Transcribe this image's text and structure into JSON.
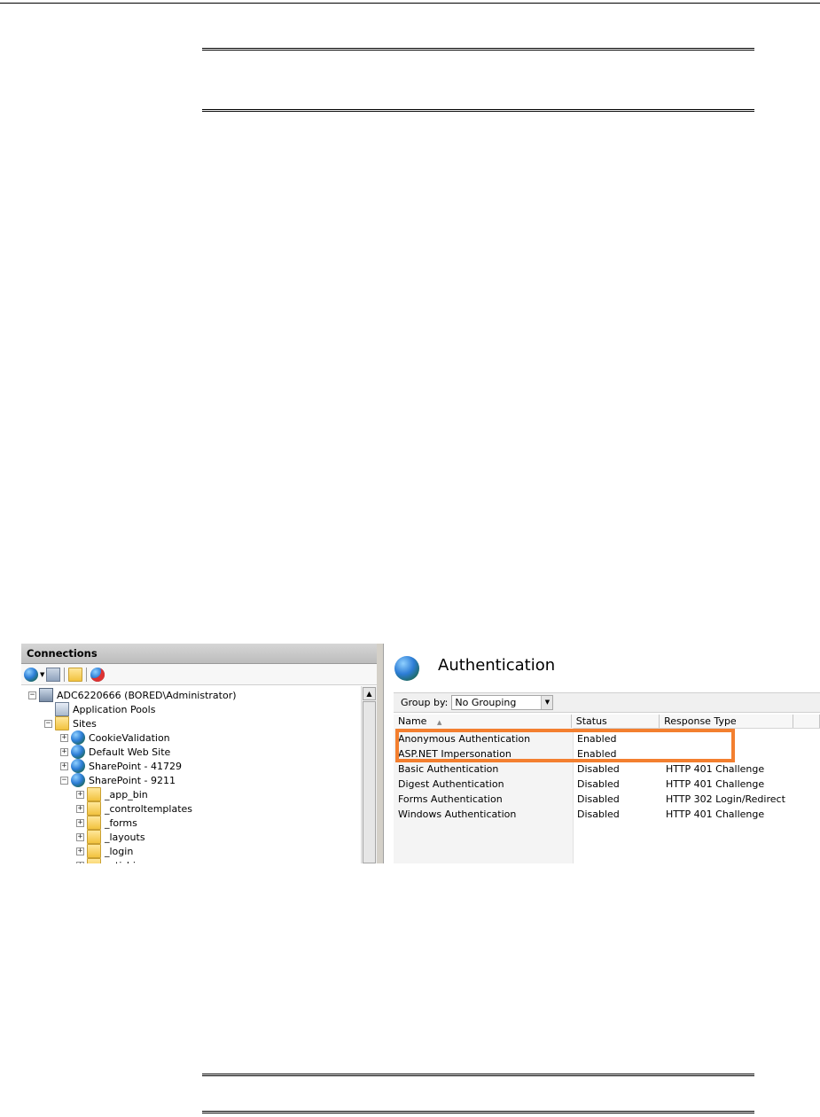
{
  "connections": {
    "title": "Connections",
    "toolbar_icons": [
      "connect-icon",
      "save-icon",
      "up-folder-icon",
      "disconnect-icon"
    ],
    "tree": [
      {
        "label": "ADC6220666 (BORED\\Administrator)",
        "level": 0,
        "icon": "server-icon",
        "expander": "−"
      },
      {
        "label": "Application Pools",
        "level": 1,
        "icon": "app-pool-icon",
        "expander": ""
      },
      {
        "label": "Sites",
        "level": 1,
        "icon": "sites-folder-icon",
        "expander": "−"
      },
      {
        "label": "CookieValidation",
        "level": 2,
        "icon": "globe-icon",
        "expander": "+"
      },
      {
        "label": "Default Web Site",
        "level": 2,
        "icon": "globe-icon",
        "expander": "+"
      },
      {
        "label": "SharePoint - 41729",
        "level": 2,
        "icon": "globe-icon",
        "expander": "+"
      },
      {
        "label": "SharePoint - 9211",
        "level": 2,
        "icon": "globe-icon",
        "expander": "−"
      },
      {
        "label": "_app_bin",
        "level": 3,
        "icon": "folder-icon",
        "expander": "+"
      },
      {
        "label": "_controltemplates",
        "level": 3,
        "icon": "folder-icon",
        "expander": "+"
      },
      {
        "label": "_forms",
        "level": 3,
        "icon": "folder-icon",
        "expander": "+"
      },
      {
        "label": "_layouts",
        "level": 3,
        "icon": "folder-icon",
        "expander": "+"
      },
      {
        "label": "_login",
        "level": 3,
        "icon": "folder-icon",
        "expander": "+"
      },
      {
        "label": "_vti_bin",
        "level": 3,
        "icon": "folder-icon",
        "expander": "+"
      }
    ]
  },
  "auth": {
    "title": "Authentication",
    "group_by_label": "Group by:",
    "group_by_value": "No Grouping",
    "columns": [
      "Name",
      "Status",
      "Response Type"
    ],
    "rows": [
      {
        "name": "Anonymous Authentication",
        "status": "Enabled",
        "response": ""
      },
      {
        "name": "ASP.NET Impersonation",
        "status": "Enabled",
        "response": ""
      },
      {
        "name": "Basic Authentication",
        "status": "Disabled",
        "response": "HTTP 401 Challenge"
      },
      {
        "name": "Digest Authentication",
        "status": "Disabled",
        "response": "HTTP 401 Challenge"
      },
      {
        "name": "Forms Authentication",
        "status": "Disabled",
        "response": "HTTP 302 Login/Redirect"
      },
      {
        "name": "Windows Authentication",
        "status": "Disabled",
        "response": "HTTP 401 Challenge"
      }
    ],
    "highlight_color": "#f37f2f"
  }
}
